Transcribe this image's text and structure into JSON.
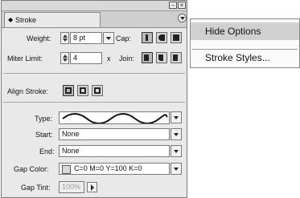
{
  "panel": {
    "tab_label": "Stroke",
    "weight": {
      "label": "Weight:",
      "value": "8 pt"
    },
    "cap": {
      "label": "Cap:"
    },
    "miter_limit": {
      "label": "Miter Limit:",
      "value": "4",
      "x_label": "x"
    },
    "join": {
      "label": "Join:"
    },
    "align_stroke": {
      "label": "Align Stroke:"
    },
    "type": {
      "label": "Type:"
    },
    "start": {
      "label": "Start:",
      "value": "None"
    },
    "end": {
      "label": "End:",
      "value": "None"
    },
    "gap_color": {
      "label": "Gap Color:",
      "value": "C=0 M=0 Y=100 K=0"
    },
    "gap_tint": {
      "label": "Gap Tint:",
      "value": "100%"
    }
  },
  "menu": {
    "items": [
      "Hide Options",
      "Stroke Styles..."
    ],
    "highlighted": "Hide Options"
  },
  "colors": {
    "panel_bg": "#e9e9e9",
    "menu_highlight": "#d0d0d0"
  }
}
